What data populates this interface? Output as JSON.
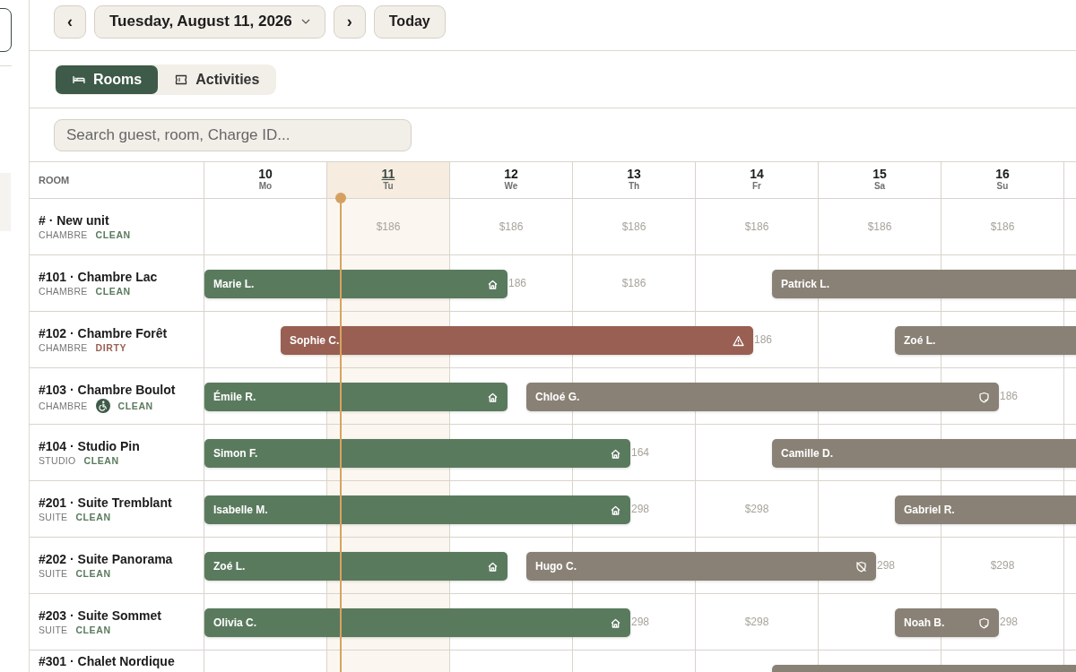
{
  "toolbar": {
    "prev": "‹",
    "date": "Tuesday, August 11, 2026",
    "next": "›",
    "today": "Today"
  },
  "view_tabs": [
    {
      "label": "Rooms",
      "kind": "rooms",
      "selected": true
    },
    {
      "label": "Activities",
      "kind": "activities",
      "selected": false
    }
  ],
  "search": {
    "placeholder": "Search guest, room, Charge ID..."
  },
  "grid": {
    "room_header": "ROOM",
    "days": [
      {
        "date": "10",
        "weekday": "Mo",
        "selected": false
      },
      {
        "date": "11",
        "weekday": "Tu",
        "selected": true
      },
      {
        "date": "12",
        "weekday": "We",
        "selected": false
      },
      {
        "date": "13",
        "weekday": "Th",
        "selected": false
      },
      {
        "date": "14",
        "weekday": "Fr",
        "selected": false
      },
      {
        "date": "15",
        "weekday": "Sa",
        "selected": false
      },
      {
        "date": "16",
        "weekday": "Su",
        "selected": false
      }
    ],
    "rooms": [
      {
        "name": "# · New unit",
        "type": "CHAMBRE",
        "status": {
          "label": "CLEAN",
          "color": "#5a7a5e"
        },
        "accessible": false,
        "cells": [
          {
            "kind": "open"
          },
          {
            "kind": "open",
            "price": "$186"
          },
          {
            "kind": "open",
            "price": "$186"
          },
          {
            "kind": "open",
            "price": "$186"
          },
          {
            "kind": "open",
            "price": "$186"
          },
          {
            "kind": "open",
            "price": "$186"
          },
          {
            "kind": "open",
            "price": "$186"
          }
        ]
      },
      {
        "name": "#101 · Chambre Lac",
        "type": "CHAMBRE",
        "status": {
          "label": "CLEAN",
          "color": "#5a7a5e"
        },
        "accessible": false,
        "carry_in": {
          "guest": "Marie L.",
          "kind": "in_house"
        },
        "cells": [
          {
            "kind": "open"
          },
          {
            "kind": "open"
          },
          {
            "kind": "departure",
            "price": "186"
          },
          {
            "kind": "open",
            "price": "$186"
          },
          {
            "kind": "arrival",
            "arrival": {
              "guest": "Patrick L.",
              "kind": "reserved"
            }
          },
          {
            "kind": "open"
          },
          {
            "kind": "open"
          }
        ]
      },
      {
        "name": "#102 · Chambre Forêt",
        "type": "CHAMBRE",
        "status": {
          "label": "DIRTY",
          "color": "#9a5f52"
        },
        "accessible": false,
        "cells": [
          {
            "kind": "arrival",
            "arrival": {
              "guest": "Sophie C.",
              "kind": "alert"
            }
          },
          {
            "kind": "open"
          },
          {
            "kind": "open"
          },
          {
            "kind": "open"
          },
          {
            "kind": "departure",
            "price": "186"
          },
          {
            "kind": "arrival",
            "arrival": {
              "guest": "Zoé L.",
              "kind": "reserved"
            }
          },
          {
            "kind": "open"
          }
        ]
      },
      {
        "name": "#103 · Chambre Boulot",
        "type": "CHAMBRE",
        "status": {
          "label": "CLEAN",
          "color": "#5a7a5e"
        },
        "accessible": true,
        "carry_in": {
          "guest": "Émile R.",
          "kind": "in_house"
        },
        "cells": [
          {
            "kind": "open"
          },
          {
            "kind": "open"
          },
          {
            "kind": "turnover",
            "arrival": {
              "guest": "Chloé G.",
              "kind": "guaranteed"
            }
          },
          {
            "kind": "open"
          },
          {
            "kind": "open"
          },
          {
            "kind": "open"
          },
          {
            "kind": "departure",
            "price": "186"
          }
        ]
      },
      {
        "name": "#104 · Studio Pin",
        "type": "STUDIO",
        "status": {
          "label": "CLEAN",
          "color": "#5a7a5e"
        },
        "accessible": false,
        "carry_in": {
          "guest": "Simon F.",
          "kind": "in_house"
        },
        "cells": [
          {
            "kind": "open"
          },
          {
            "kind": "open"
          },
          {
            "kind": "open"
          },
          {
            "kind": "departure",
            "price": "164"
          },
          {
            "kind": "arrival",
            "arrival": {
              "guest": "Camille D.",
              "kind": "reserved"
            }
          },
          {
            "kind": "open"
          },
          {
            "kind": "open"
          }
        ]
      },
      {
        "name": "#201 · Suite Tremblant",
        "type": "SUITE",
        "status": {
          "label": "CLEAN",
          "color": "#5a7a5e"
        },
        "accessible": false,
        "carry_in": {
          "guest": "Isabelle M.",
          "kind": "in_house"
        },
        "cells": [
          {
            "kind": "open"
          },
          {
            "kind": "open"
          },
          {
            "kind": "open"
          },
          {
            "kind": "departure",
            "price": "298"
          },
          {
            "kind": "open",
            "price": "$298"
          },
          {
            "kind": "arrival",
            "arrival": {
              "guest": "Gabriel R.",
              "kind": "reserved"
            }
          },
          {
            "kind": "open"
          }
        ]
      },
      {
        "name": "#202 · Suite Panorama",
        "type": "SUITE",
        "status": {
          "label": "CLEAN",
          "color": "#5a7a5e"
        },
        "accessible": false,
        "carry_in": {
          "guest": "Zoé L.",
          "kind": "in_house"
        },
        "cells": [
          {
            "kind": "open"
          },
          {
            "kind": "open"
          },
          {
            "kind": "turnover",
            "arrival": {
              "guest": "Hugo C.",
              "kind": "unguaranteed"
            }
          },
          {
            "kind": "open"
          },
          {
            "kind": "open"
          },
          {
            "kind": "departure",
            "price": "298"
          },
          {
            "kind": "open",
            "price": "$298"
          }
        ]
      },
      {
        "name": "#203 · Suite Sommet",
        "type": "SUITE",
        "status": {
          "label": "CLEAN",
          "color": "#5a7a5e"
        },
        "accessible": false,
        "carry_in": {
          "guest": "Olivia C.",
          "kind": "in_house"
        },
        "cells": [
          {
            "kind": "open"
          },
          {
            "kind": "open"
          },
          {
            "kind": "open"
          },
          {
            "kind": "departure",
            "price": "298"
          },
          {
            "kind": "open",
            "price": "$298"
          },
          {
            "kind": "arrival",
            "arrival": {
              "guest": "Noah B.",
              "kind": "guaranteed"
            }
          },
          {
            "kind": "departure",
            "price": "298"
          }
        ]
      },
      {
        "name": "#301 · Chalet Nordique",
        "accessible": false,
        "cells": [
          {
            "kind": "open"
          },
          {
            "kind": "open"
          },
          {
            "kind": "open"
          },
          {
            "kind": "open"
          },
          {
            "kind": "arrival",
            "arrival": {
              "kind": "reserved"
            }
          },
          {
            "kind": "open"
          },
          {
            "kind": "open"
          }
        ]
      }
    ]
  }
}
